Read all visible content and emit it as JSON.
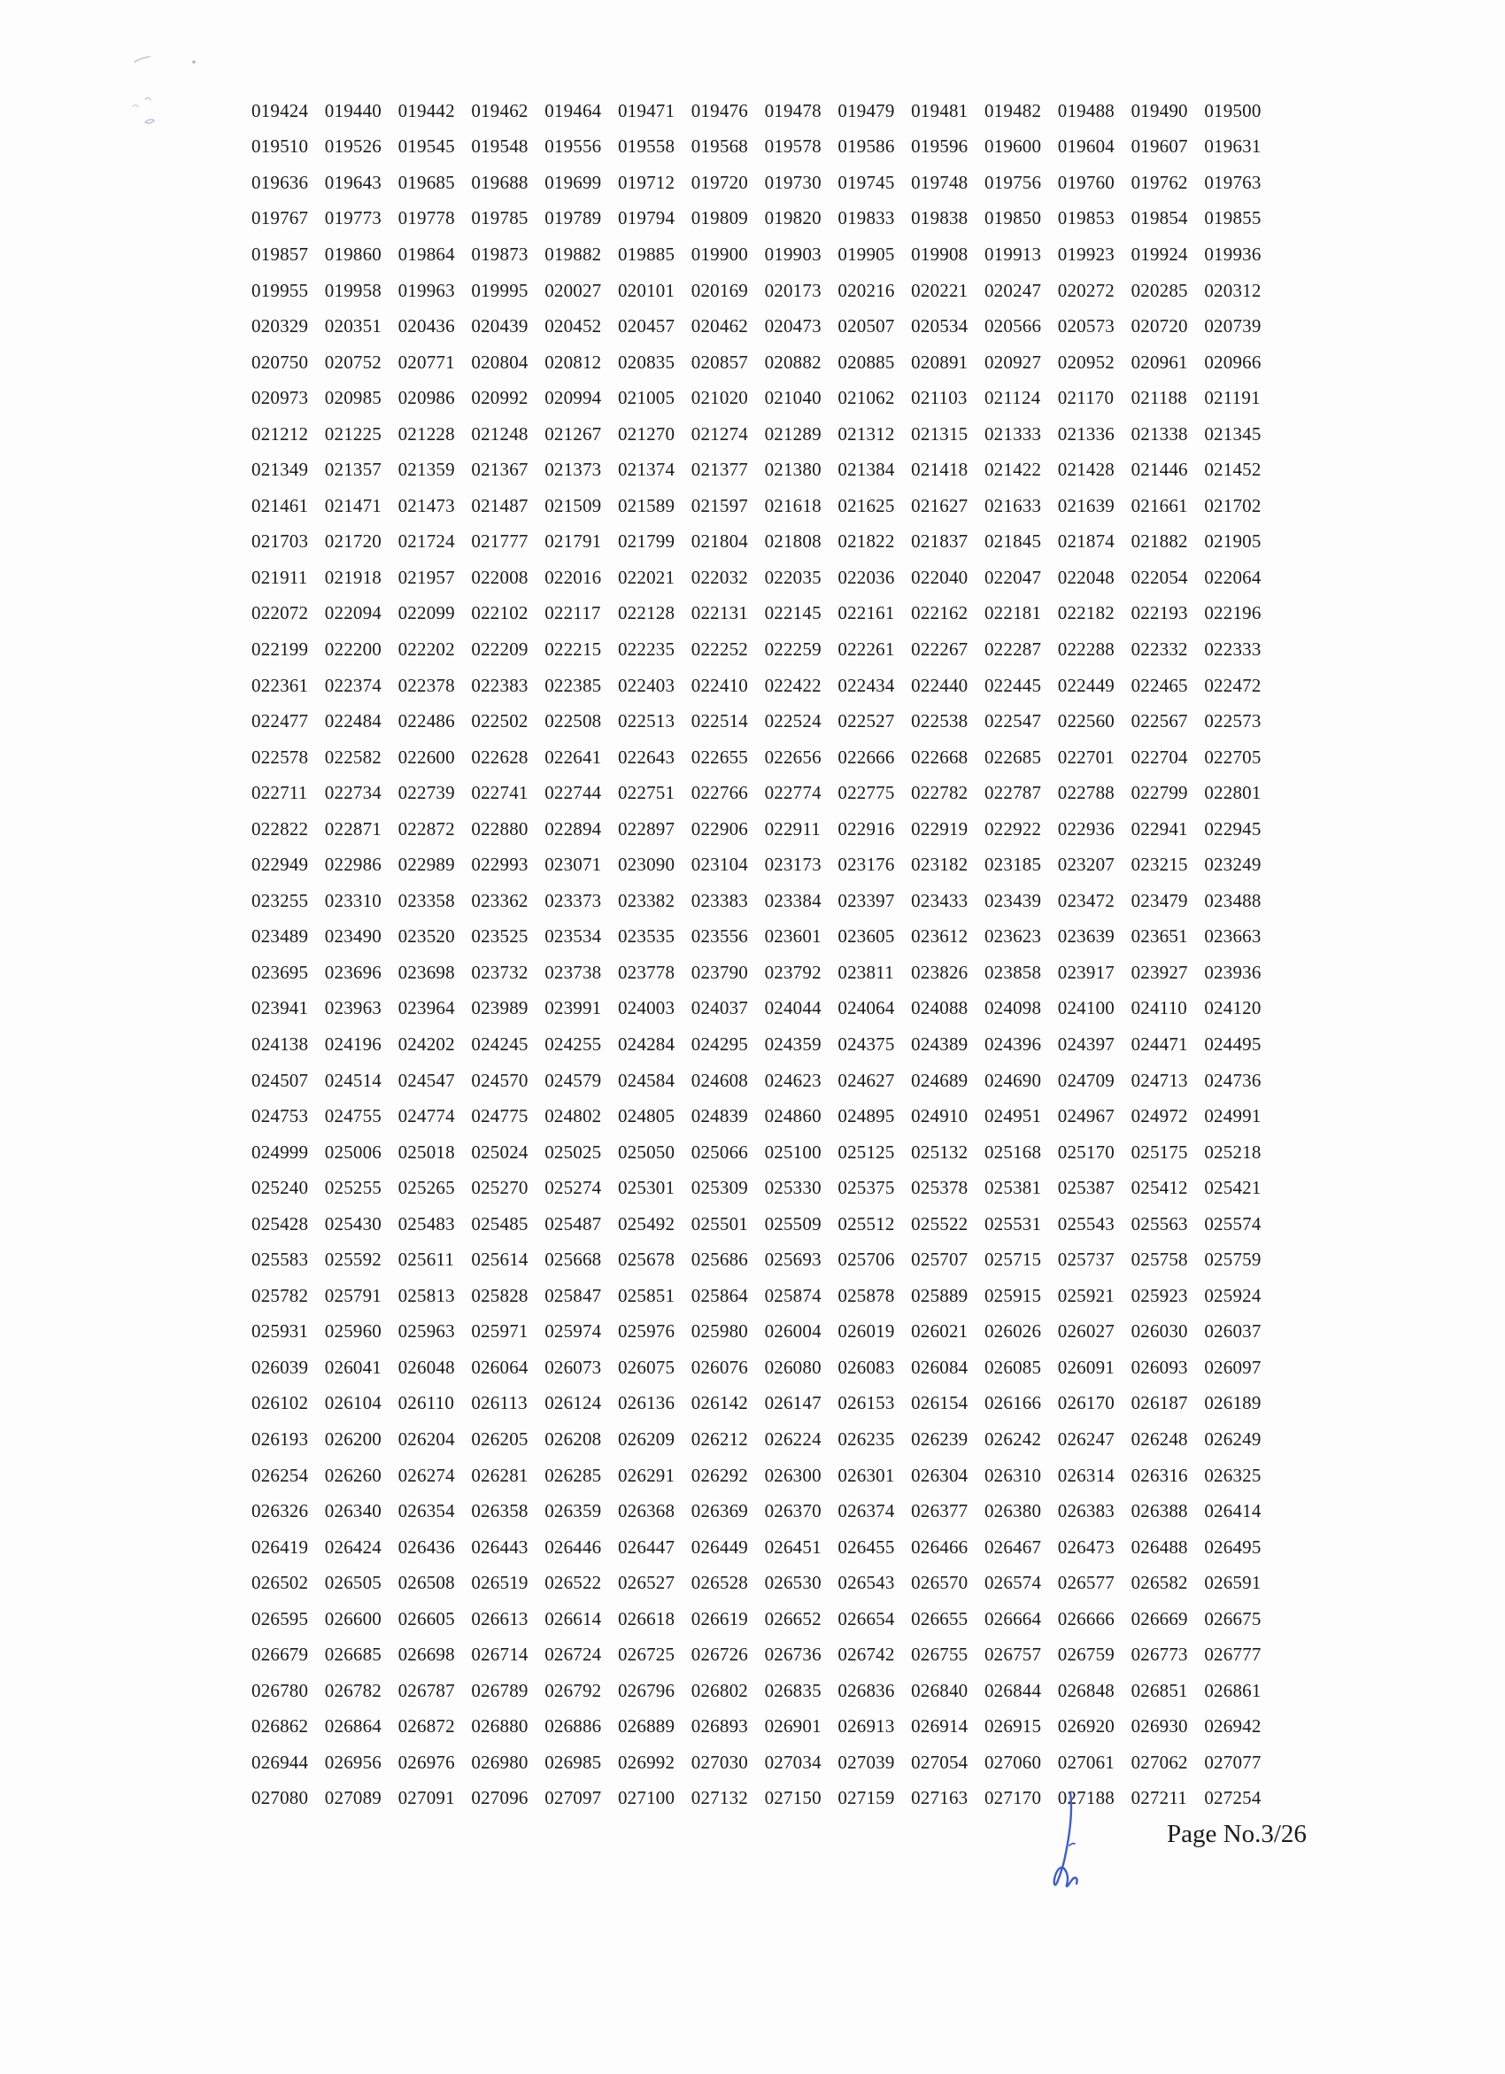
{
  "document": {
    "rows": [
      [
        "019424",
        "019440",
        "019442",
        "019462",
        "019464",
        "019471",
        "019476",
        "019478",
        "019479",
        "019481",
        "019482",
        "019488",
        "019490",
        "019500"
      ],
      [
        "019510",
        "019526",
        "019545",
        "019548",
        "019556",
        "019558",
        "019568",
        "019578",
        "019586",
        "019596",
        "019600",
        "019604",
        "019607",
        "019631"
      ],
      [
        "019636",
        "019643",
        "019685",
        "019688",
        "019699",
        "019712",
        "019720",
        "019730",
        "019745",
        "019748",
        "019756",
        "019760",
        "019762",
        "019763"
      ],
      [
        "019767",
        "019773",
        "019778",
        "019785",
        "019789",
        "019794",
        "019809",
        "019820",
        "019833",
        "019838",
        "019850",
        "019853",
        "019854",
        "019855"
      ],
      [
        "019857",
        "019860",
        "019864",
        "019873",
        "019882",
        "019885",
        "019900",
        "019903",
        "019905",
        "019908",
        "019913",
        "019923",
        "019924",
        "019936"
      ],
      [
        "019955",
        "019958",
        "019963",
        "019995",
        "020027",
        "020101",
        "020169",
        "020173",
        "020216",
        "020221",
        "020247",
        "020272",
        "020285",
        "020312"
      ],
      [
        "020329",
        "020351",
        "020436",
        "020439",
        "020452",
        "020457",
        "020462",
        "020473",
        "020507",
        "020534",
        "020566",
        "020573",
        "020720",
        "020739"
      ],
      [
        "020750",
        "020752",
        "020771",
        "020804",
        "020812",
        "020835",
        "020857",
        "020882",
        "020885",
        "020891",
        "020927",
        "020952",
        "020961",
        "020966"
      ],
      [
        "020973",
        "020985",
        "020986",
        "020992",
        "020994",
        "021005",
        "021020",
        "021040",
        "021062",
        "021103",
        "021124",
        "021170",
        "021188",
        "021191"
      ],
      [
        "021212",
        "021225",
        "021228",
        "021248",
        "021267",
        "021270",
        "021274",
        "021289",
        "021312",
        "021315",
        "021333",
        "021336",
        "021338",
        "021345"
      ],
      [
        "021349",
        "021357",
        "021359",
        "021367",
        "021373",
        "021374",
        "021377",
        "021380",
        "021384",
        "021418",
        "021422",
        "021428",
        "021446",
        "021452"
      ],
      [
        "021461",
        "021471",
        "021473",
        "021487",
        "021509",
        "021589",
        "021597",
        "021618",
        "021625",
        "021627",
        "021633",
        "021639",
        "021661",
        "021702"
      ],
      [
        "021703",
        "021720",
        "021724",
        "021777",
        "021791",
        "021799",
        "021804",
        "021808",
        "021822",
        "021837",
        "021845",
        "021874",
        "021882",
        "021905"
      ],
      [
        "021911",
        "021918",
        "021957",
        "022008",
        "022016",
        "022021",
        "022032",
        "022035",
        "022036",
        "022040",
        "022047",
        "022048",
        "022054",
        "022064"
      ],
      [
        "022072",
        "022094",
        "022099",
        "022102",
        "022117",
        "022128",
        "022131",
        "022145",
        "022161",
        "022162",
        "022181",
        "022182",
        "022193",
        "022196"
      ],
      [
        "022199",
        "022200",
        "022202",
        "022209",
        "022215",
        "022235",
        "022252",
        "022259",
        "022261",
        "022267",
        "022287",
        "022288",
        "022332",
        "022333"
      ],
      [
        "022361",
        "022374",
        "022378",
        "022383",
        "022385",
        "022403",
        "022410",
        "022422",
        "022434",
        "022440",
        "022445",
        "022449",
        "022465",
        "022472"
      ],
      [
        "022477",
        "022484",
        "022486",
        "022502",
        "022508",
        "022513",
        "022514",
        "022524",
        "022527",
        "022538",
        "022547",
        "022560",
        "022567",
        "022573"
      ],
      [
        "022578",
        "022582",
        "022600",
        "022628",
        "022641",
        "022643",
        "022655",
        "022656",
        "022666",
        "022668",
        "022685",
        "022701",
        "022704",
        "022705"
      ],
      [
        "022711",
        "022734",
        "022739",
        "022741",
        "022744",
        "022751",
        "022766",
        "022774",
        "022775",
        "022782",
        "022787",
        "022788",
        "022799",
        "022801"
      ],
      [
        "022822",
        "022871",
        "022872",
        "022880",
        "022894",
        "022897",
        "022906",
        "022911",
        "022916",
        "022919",
        "022922",
        "022936",
        "022941",
        "022945"
      ],
      [
        "022949",
        "022986",
        "022989",
        "022993",
        "023071",
        "023090",
        "023104",
        "023173",
        "023176",
        "023182",
        "023185",
        "023207",
        "023215",
        "023249"
      ],
      [
        "023255",
        "023310",
        "023358",
        "023362",
        "023373",
        "023382",
        "023383",
        "023384",
        "023397",
        "023433",
        "023439",
        "023472",
        "023479",
        "023488"
      ],
      [
        "023489",
        "023490",
        "023520",
        "023525",
        "023534",
        "023535",
        "023556",
        "023601",
        "023605",
        "023612",
        "023623",
        "023639",
        "023651",
        "023663"
      ],
      [
        "023695",
        "023696",
        "023698",
        "023732",
        "023738",
        "023778",
        "023790",
        "023792",
        "023811",
        "023826",
        "023858",
        "023917",
        "023927",
        "023936"
      ],
      [
        "023941",
        "023963",
        "023964",
        "023989",
        "023991",
        "024003",
        "024037",
        "024044",
        "024064",
        "024088",
        "024098",
        "024100",
        "024110",
        "024120"
      ],
      [
        "024138",
        "024196",
        "024202",
        "024245",
        "024255",
        "024284",
        "024295",
        "024359",
        "024375",
        "024389",
        "024396",
        "024397",
        "024471",
        "024495"
      ],
      [
        "024507",
        "024514",
        "024547",
        "024570",
        "024579",
        "024584",
        "024608",
        "024623",
        "024627",
        "024689",
        "024690",
        "024709",
        "024713",
        "024736"
      ],
      [
        "024753",
        "024755",
        "024774",
        "024775",
        "024802",
        "024805",
        "024839",
        "024860",
        "024895",
        "024910",
        "024951",
        "024967",
        "024972",
        "024991"
      ],
      [
        "024999",
        "025006",
        "025018",
        "025024",
        "025025",
        "025050",
        "025066",
        "025100",
        "025125",
        "025132",
        "025168",
        "025170",
        "025175",
        "025218"
      ],
      [
        "025240",
        "025255",
        "025265",
        "025270",
        "025274",
        "025301",
        "025309",
        "025330",
        "025375",
        "025378",
        "025381",
        "025387",
        "025412",
        "025421"
      ],
      [
        "025428",
        "025430",
        "025483",
        "025485",
        "025487",
        "025492",
        "025501",
        "025509",
        "025512",
        "025522",
        "025531",
        "025543",
        "025563",
        "025574"
      ],
      [
        "025583",
        "025592",
        "025611",
        "025614",
        "025668",
        "025678",
        "025686",
        "025693",
        "025706",
        "025707",
        "025715",
        "025737",
        "025758",
        "025759"
      ],
      [
        "025782",
        "025791",
        "025813",
        "025828",
        "025847",
        "025851",
        "025864",
        "025874",
        "025878",
        "025889",
        "025915",
        "025921",
        "025923",
        "025924"
      ],
      [
        "025931",
        "025960",
        "025963",
        "025971",
        "025974",
        "025976",
        "025980",
        "026004",
        "026019",
        "026021",
        "026026",
        "026027",
        "026030",
        "026037"
      ],
      [
        "026039",
        "026041",
        "026048",
        "026064",
        "026073",
        "026075",
        "026076",
        "026080",
        "026083",
        "026084",
        "026085",
        "026091",
        "026093",
        "026097"
      ],
      [
        "026102",
        "026104",
        "026110",
        "026113",
        "026124",
        "026136",
        "026142",
        "026147",
        "026153",
        "026154",
        "026166",
        "026170",
        "026187",
        "026189"
      ],
      [
        "026193",
        "026200",
        "026204",
        "026205",
        "026208",
        "026209",
        "026212",
        "026224",
        "026235",
        "026239",
        "026242",
        "026247",
        "026248",
        "026249"
      ],
      [
        "026254",
        "026260",
        "026274",
        "026281",
        "026285",
        "026291",
        "026292",
        "026300",
        "026301",
        "026304",
        "026310",
        "026314",
        "026316",
        "026325"
      ],
      [
        "026326",
        "026340",
        "026354",
        "026358",
        "026359",
        "026368",
        "026369",
        "026370",
        "026374",
        "026377",
        "026380",
        "026383",
        "026388",
        "026414"
      ],
      [
        "026419",
        "026424",
        "026436",
        "026443",
        "026446",
        "026447",
        "026449",
        "026451",
        "026455",
        "026466",
        "026467",
        "026473",
        "026488",
        "026495"
      ],
      [
        "026502",
        "026505",
        "026508",
        "026519",
        "026522",
        "026527",
        "026528",
        "026530",
        "026543",
        "026570",
        "026574",
        "026577",
        "026582",
        "026591"
      ],
      [
        "026595",
        "026600",
        "026605",
        "026613",
        "026614",
        "026618",
        "026619",
        "026652",
        "026654",
        "026655",
        "026664",
        "026666",
        "026669",
        "026675"
      ],
      [
        "026679",
        "026685",
        "026698",
        "026714",
        "026724",
        "026725",
        "026726",
        "026736",
        "026742",
        "026755",
        "026757",
        "026759",
        "026773",
        "026777"
      ],
      [
        "026780",
        "026782",
        "026787",
        "026789",
        "026792",
        "026796",
        "026802",
        "026835",
        "026836",
        "026840",
        "026844",
        "026848",
        "026851",
        "026861"
      ],
      [
        "026862",
        "026864",
        "026872",
        "026880",
        "026886",
        "026889",
        "026893",
        "026901",
        "026913",
        "026914",
        "026915",
        "026920",
        "026930",
        "026942"
      ],
      [
        "026944",
        "026956",
        "026976",
        "026980",
        "026985",
        "026992",
        "027030",
        "027034",
        "027039",
        "027054",
        "027060",
        "027061",
        "027062",
        "027077"
      ],
      [
        "027080",
        "027089",
        "027091",
        "027096",
        "027097",
        "027100",
        "027132",
        "027150",
        "027159",
        "027163",
        "027170",
        "027188",
        "027211",
        "027254"
      ]
    ],
    "page_number": "Page No.3/26"
  },
  "colors": {
    "text": "#1a1a1a",
    "signature_ink": "#3e5fc4"
  }
}
